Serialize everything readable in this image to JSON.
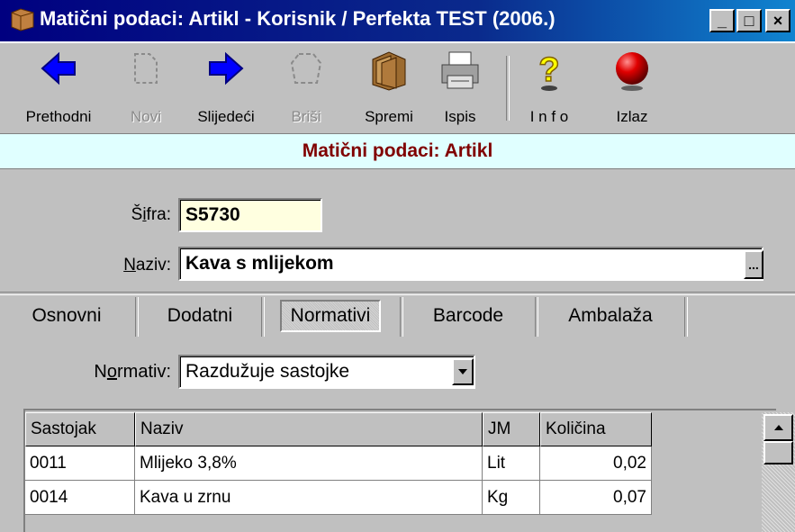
{
  "window": {
    "title": "Matični podaci: Artikl - Korisnik / Perfekta TEST (2006.)",
    "buttons": {
      "minimize": "_",
      "maximize": "□",
      "close": "×"
    }
  },
  "toolbar": {
    "prev": "Prethodni",
    "new": "Novi",
    "next": "Slijedeći",
    "delete": "Briši",
    "save": "Spremi",
    "print": "Ispis",
    "info": "I n f o",
    "exit": "Izlaz"
  },
  "header": {
    "title": "Matični podaci: Artikl"
  },
  "form": {
    "sifra_label_pre": "Š",
    "sifra_label_u": "i",
    "sifra_label_post": "fra:",
    "sifra_value": "S5730",
    "naziv_label_u": "N",
    "naziv_label_post": "aziv:",
    "naziv_value": "Kava s mlijekom",
    "naziv_button": "..."
  },
  "tabs": [
    "Osnovni",
    "Dodatni",
    "Normativi",
    "Barcode",
    "Ambalaža"
  ],
  "active_tab": "Normativi",
  "normativ": {
    "label_pre": "N",
    "label_u": "o",
    "label_post": "rmativ:",
    "value": "Razdužuje sastojke"
  },
  "grid": {
    "columns": [
      "Sastojak",
      "Naziv",
      "JM",
      "Količina"
    ],
    "rows": [
      [
        "0011",
        "Mlijeko 3,8%",
        "Lit",
        "0,02"
      ],
      [
        "0014",
        "Kava u zrnu",
        "Kg",
        "0,07"
      ]
    ]
  },
  "colors": {
    "title_bar": "#000080",
    "band_bg": "#e0ffff",
    "band_text": "#800000",
    "code_field_bg": "#ffffe0"
  }
}
